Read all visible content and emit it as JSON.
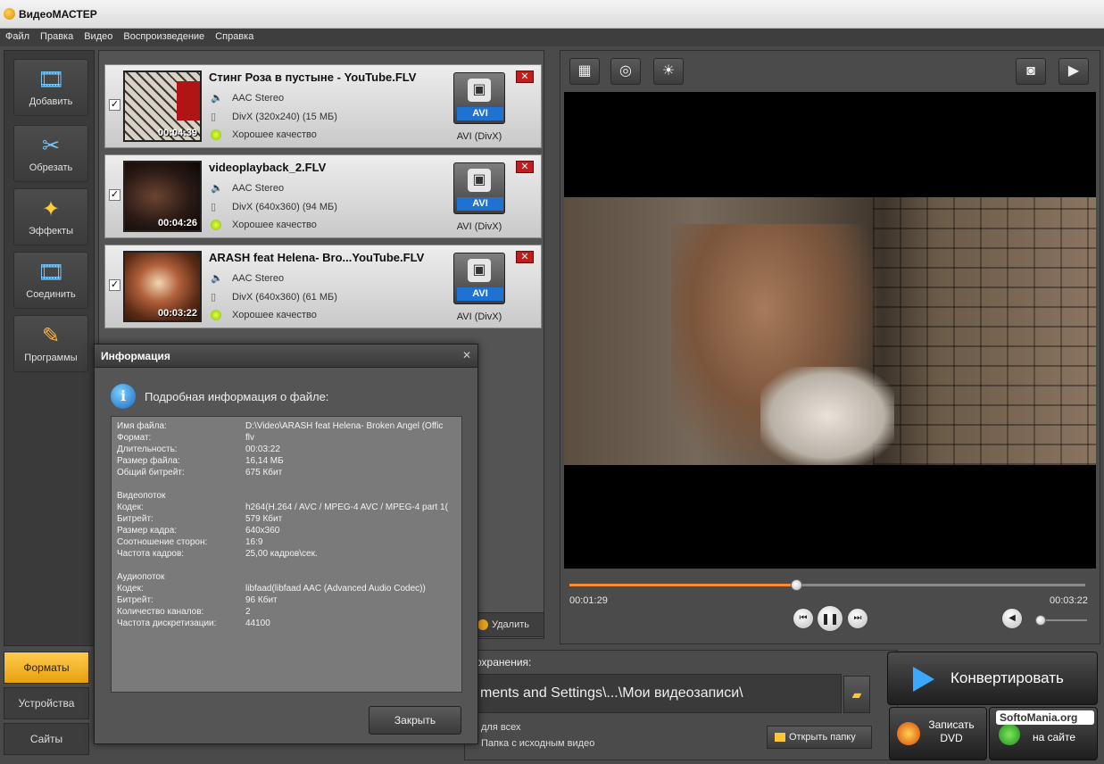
{
  "app": {
    "title": "ВидеоМАСТЕР"
  },
  "menu": [
    "Файл",
    "Правка",
    "Видео",
    "Воспроизведение",
    "Справка"
  ],
  "nav": [
    {
      "label": "Добавить",
      "icon": "add-film-icon"
    },
    {
      "label": "Обрезать",
      "icon": "scissors-icon"
    },
    {
      "label": "Эффекты",
      "icon": "magic-wand-icon"
    },
    {
      "label": "Соединить",
      "icon": "join-film-icon"
    },
    {
      "label": "Программы",
      "icon": "programs-icon"
    }
  ],
  "bottom_tabs": [
    {
      "label": "Форматы",
      "active": true
    },
    {
      "label": "Устройства",
      "active": false
    },
    {
      "label": "Сайты",
      "active": false
    }
  ],
  "files": [
    {
      "name": "Стинг Роза в пустыне - YouTube.FLV",
      "audio": "AAC Stereo",
      "video": "DivX (320x240) (15 МБ)",
      "quality": "Хорошее качество",
      "duration": "00:04:39",
      "format_badge": "AVI",
      "format_label": "AVI (DivX)",
      "checked": true
    },
    {
      "name": "videoplayback_2.FLV",
      "audio": "AAC Stereo",
      "video": "DivX (640x360) (94 МБ)",
      "quality": "Хорошее качество",
      "duration": "00:04:26",
      "format_badge": "AVI",
      "format_label": "AVI (DivX)",
      "checked": true
    },
    {
      "name": "ARASH feat Helena- Bro...YouTube.FLV",
      "audio": "AAC Stereo",
      "video": "DivX (640x360) (61 МБ)",
      "quality": "Хорошее качество",
      "duration": "00:03:22",
      "format_badge": "AVI",
      "format_label": "AVI (DivX)",
      "checked": true
    }
  ],
  "list_actions": {
    "delete_label": "Удалить"
  },
  "player": {
    "current_time": "00:01:29",
    "total_time": "00:03:22",
    "progress_fraction": 0.44,
    "volume_fraction": 0.0
  },
  "output": {
    "label": "охранения:",
    "path": "ments and Settings\\...\\Мои видеозаписи\\",
    "option_all": "для всех",
    "option_source_folder": "Папка с исходным видео",
    "open_folder_label": "Открыть папку"
  },
  "actions": {
    "convert_label": "Конвертировать",
    "dvd_line1": "Записать",
    "dvd_line2": "DVD",
    "publish_label": "на сайте"
  },
  "watermark": "SoftoMania.org",
  "dialog": {
    "title": "Информация",
    "subtitle": "Подробная информация о файле:",
    "general": [
      {
        "k": "Имя файла:",
        "v": "D:\\Video\\ARASH feat Helena- Broken Angel (Offic"
      },
      {
        "k": "Формат:",
        "v": "flv"
      },
      {
        "k": "Длительность:",
        "v": "00:03:22"
      },
      {
        "k": "Размер файла:",
        "v": "16,14 МБ"
      },
      {
        "k": "Общий битрейт:",
        "v": "675 Кбит"
      }
    ],
    "video_header": "Видеопоток",
    "video": [
      {
        "k": "Кодек:",
        "v": "h264(H.264 / AVC / MPEG-4 AVC / MPEG-4 part 1("
      },
      {
        "k": "Битрейт:",
        "v": "579 Кбит"
      },
      {
        "k": "Размер кадра:",
        "v": "640x360"
      },
      {
        "k": "Соотношение сторон:",
        "v": "16:9"
      },
      {
        "k": "Частота кадров:",
        "v": "25,00 кадров\\сек."
      }
    ],
    "audio_header": "Аудиопоток",
    "audio": [
      {
        "k": "Кодек:",
        "v": "libfaad(libfaad AAC (Advanced Audio Codec))"
      },
      {
        "k": "Битрейт:",
        "v": "96 Кбит"
      },
      {
        "k": "Количество каналов:",
        "v": "2"
      },
      {
        "k": "Частота дискретизации:",
        "v": "44100"
      }
    ],
    "close_label": "Закрыть"
  },
  "colors": {
    "accent_orange": "#ff8a2a",
    "active_tab": "#ffcc4d",
    "format_badge": "#1f72d1",
    "remove_red": "#c11d1d"
  }
}
